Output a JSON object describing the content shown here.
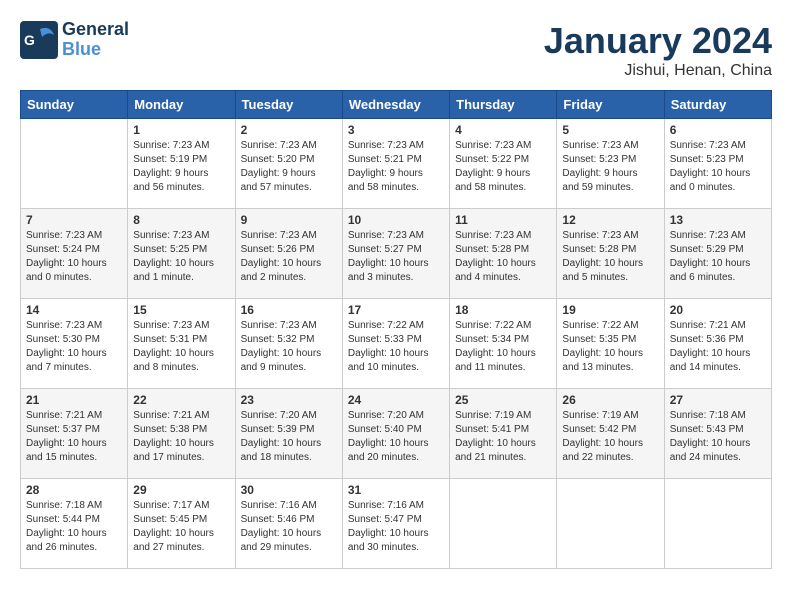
{
  "header": {
    "logo_line1": "General",
    "logo_line2": "Blue",
    "title": "January 2024",
    "subtitle": "Jishui, Henan, China"
  },
  "weekdays": [
    "Sunday",
    "Monday",
    "Tuesday",
    "Wednesday",
    "Thursday",
    "Friday",
    "Saturday"
  ],
  "weeks": [
    [
      {
        "day": "",
        "info": ""
      },
      {
        "day": "1",
        "info": "Sunrise: 7:23 AM\nSunset: 5:19 PM\nDaylight: 9 hours\nand 56 minutes."
      },
      {
        "day": "2",
        "info": "Sunrise: 7:23 AM\nSunset: 5:20 PM\nDaylight: 9 hours\nand 57 minutes."
      },
      {
        "day": "3",
        "info": "Sunrise: 7:23 AM\nSunset: 5:21 PM\nDaylight: 9 hours\nand 58 minutes."
      },
      {
        "day": "4",
        "info": "Sunrise: 7:23 AM\nSunset: 5:22 PM\nDaylight: 9 hours\nand 58 minutes."
      },
      {
        "day": "5",
        "info": "Sunrise: 7:23 AM\nSunset: 5:23 PM\nDaylight: 9 hours\nand 59 minutes."
      },
      {
        "day": "6",
        "info": "Sunrise: 7:23 AM\nSunset: 5:23 PM\nDaylight: 10 hours\nand 0 minutes."
      }
    ],
    [
      {
        "day": "7",
        "info": "Sunrise: 7:23 AM\nSunset: 5:24 PM\nDaylight: 10 hours\nand 0 minutes."
      },
      {
        "day": "8",
        "info": "Sunrise: 7:23 AM\nSunset: 5:25 PM\nDaylight: 10 hours\nand 1 minute."
      },
      {
        "day": "9",
        "info": "Sunrise: 7:23 AM\nSunset: 5:26 PM\nDaylight: 10 hours\nand 2 minutes."
      },
      {
        "day": "10",
        "info": "Sunrise: 7:23 AM\nSunset: 5:27 PM\nDaylight: 10 hours\nand 3 minutes."
      },
      {
        "day": "11",
        "info": "Sunrise: 7:23 AM\nSunset: 5:28 PM\nDaylight: 10 hours\nand 4 minutes."
      },
      {
        "day": "12",
        "info": "Sunrise: 7:23 AM\nSunset: 5:28 PM\nDaylight: 10 hours\nand 5 minutes."
      },
      {
        "day": "13",
        "info": "Sunrise: 7:23 AM\nSunset: 5:29 PM\nDaylight: 10 hours\nand 6 minutes."
      }
    ],
    [
      {
        "day": "14",
        "info": "Sunrise: 7:23 AM\nSunset: 5:30 PM\nDaylight: 10 hours\nand 7 minutes."
      },
      {
        "day": "15",
        "info": "Sunrise: 7:23 AM\nSunset: 5:31 PM\nDaylight: 10 hours\nand 8 minutes."
      },
      {
        "day": "16",
        "info": "Sunrise: 7:23 AM\nSunset: 5:32 PM\nDaylight: 10 hours\nand 9 minutes."
      },
      {
        "day": "17",
        "info": "Sunrise: 7:22 AM\nSunset: 5:33 PM\nDaylight: 10 hours\nand 10 minutes."
      },
      {
        "day": "18",
        "info": "Sunrise: 7:22 AM\nSunset: 5:34 PM\nDaylight: 10 hours\nand 11 minutes."
      },
      {
        "day": "19",
        "info": "Sunrise: 7:22 AM\nSunset: 5:35 PM\nDaylight: 10 hours\nand 13 minutes."
      },
      {
        "day": "20",
        "info": "Sunrise: 7:21 AM\nSunset: 5:36 PM\nDaylight: 10 hours\nand 14 minutes."
      }
    ],
    [
      {
        "day": "21",
        "info": "Sunrise: 7:21 AM\nSunset: 5:37 PM\nDaylight: 10 hours\nand 15 minutes."
      },
      {
        "day": "22",
        "info": "Sunrise: 7:21 AM\nSunset: 5:38 PM\nDaylight: 10 hours\nand 17 minutes."
      },
      {
        "day": "23",
        "info": "Sunrise: 7:20 AM\nSunset: 5:39 PM\nDaylight: 10 hours\nand 18 minutes."
      },
      {
        "day": "24",
        "info": "Sunrise: 7:20 AM\nSunset: 5:40 PM\nDaylight: 10 hours\nand 20 minutes."
      },
      {
        "day": "25",
        "info": "Sunrise: 7:19 AM\nSunset: 5:41 PM\nDaylight: 10 hours\nand 21 minutes."
      },
      {
        "day": "26",
        "info": "Sunrise: 7:19 AM\nSunset: 5:42 PM\nDaylight: 10 hours\nand 22 minutes."
      },
      {
        "day": "27",
        "info": "Sunrise: 7:18 AM\nSunset: 5:43 PM\nDaylight: 10 hours\nand 24 minutes."
      }
    ],
    [
      {
        "day": "28",
        "info": "Sunrise: 7:18 AM\nSunset: 5:44 PM\nDaylight: 10 hours\nand 26 minutes."
      },
      {
        "day": "29",
        "info": "Sunrise: 7:17 AM\nSunset: 5:45 PM\nDaylight: 10 hours\nand 27 minutes."
      },
      {
        "day": "30",
        "info": "Sunrise: 7:16 AM\nSunset: 5:46 PM\nDaylight: 10 hours\nand 29 minutes."
      },
      {
        "day": "31",
        "info": "Sunrise: 7:16 AM\nSunset: 5:47 PM\nDaylight: 10 hours\nand 30 minutes."
      },
      {
        "day": "",
        "info": ""
      },
      {
        "day": "",
        "info": ""
      },
      {
        "day": "",
        "info": ""
      }
    ]
  ]
}
